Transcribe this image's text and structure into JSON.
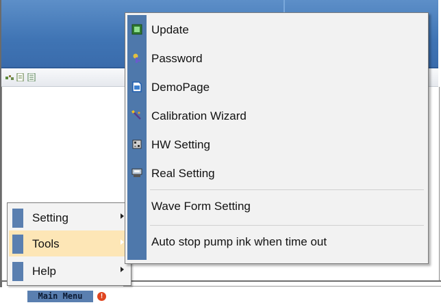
{
  "main_menu": {
    "items": [
      {
        "label": "Setting",
        "has_submenu": true,
        "active": false
      },
      {
        "label": "Tools",
        "has_submenu": true,
        "active": true
      },
      {
        "label": "Help",
        "has_submenu": true,
        "active": false
      }
    ]
  },
  "tools_submenu": {
    "items": [
      {
        "label": "Update",
        "icon": "update-icon"
      },
      {
        "label": "Password",
        "icon": "password-icon"
      },
      {
        "label": "DemoPage",
        "icon": "demopage-icon"
      },
      {
        "label": "Calibration Wizard",
        "icon": "calibration-wizard-icon"
      },
      {
        "label": "HW Setting",
        "icon": "hw-setting-icon"
      },
      {
        "label": "Real Setting",
        "icon": "real-setting-icon"
      },
      {
        "label": "Wave Form Setting",
        "icon": null
      },
      {
        "label": "Auto stop pump ink when time out",
        "icon": null
      }
    ]
  },
  "statusbar": {
    "main_menu_label": "Main Menu",
    "info_icon_glyph": "!"
  },
  "colors": {
    "header_blue": "#3f74b4",
    "menu_gutter": "#4e78ab",
    "menu_highlight": "#fde6b6",
    "menu_bg": "#f2f2f2"
  }
}
